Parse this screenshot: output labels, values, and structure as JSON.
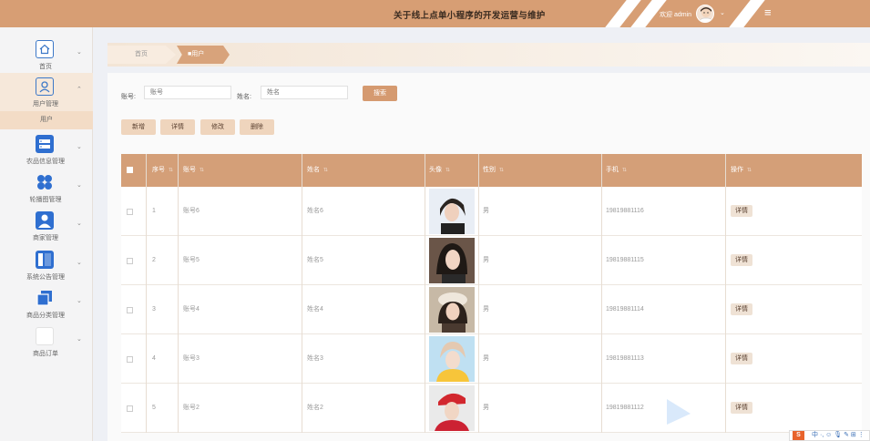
{
  "header": {
    "title": "关于线上点单小程序的开发运营与维护",
    "welcome": "欢迎 admin",
    "user_caret": "⌄",
    "menu_icon": "≡"
  },
  "sidebar": {
    "items": [
      {
        "label": "首页",
        "icon": "home-icon"
      },
      {
        "label": "用户管理",
        "icon": "user-icon"
      },
      {
        "label": "农品信息管理",
        "icon": "database-icon"
      },
      {
        "label": "轮播图管理",
        "icon": "grid-icon"
      },
      {
        "label": "商家管理",
        "icon": "person-icon"
      },
      {
        "label": "系统公告管理",
        "icon": "notice-icon"
      },
      {
        "label": "商品分类管理",
        "icon": "copy-icon"
      },
      {
        "label": "商品订单",
        "icon": "order-icon"
      }
    ],
    "submenu": {
      "label": "用户"
    },
    "chevron": "⌄",
    "chevron_open": "⌃"
  },
  "breadcrumb": {
    "home": "首页",
    "current": "■用户",
    "close": "×"
  },
  "search": {
    "account_label": "账号:",
    "account_placeholder": "账号",
    "name_label": "姓名:",
    "name_placeholder": "姓名",
    "button": "搜索"
  },
  "toolbar": {
    "add": "新增",
    "detail": "详情",
    "edit": "修改",
    "delete": "删除"
  },
  "table": {
    "columns": [
      "序号",
      "账号",
      "姓名",
      "头像",
      "性别",
      "手机",
      "操作"
    ],
    "sort_glyph": "⇅",
    "detail_label": "详情",
    "rows": [
      {
        "index": "1",
        "account": "账号6",
        "name": "姓名6",
        "gender": "男",
        "phone": "19819881116"
      },
      {
        "index": "2",
        "account": "账号5",
        "name": "姓名5",
        "gender": "男",
        "phone": "19819881115"
      },
      {
        "index": "3",
        "account": "账号4",
        "name": "姓名4",
        "gender": "男",
        "phone": "19819881114"
      },
      {
        "index": "4",
        "account": "账号3",
        "name": "姓名3",
        "gender": "男",
        "phone": "19819881113"
      },
      {
        "index": "5",
        "account": "账号2",
        "name": "姓名2",
        "gender": "男",
        "phone": "19819881112"
      }
    ]
  },
  "ime": {
    "logo": "S",
    "text": "中 ·, ☺ 🎙 ✎ ⊞ ⋮"
  },
  "colors": {
    "accent": "#d79e74",
    "table_header": "#d49f78",
    "button": "#efd5bd",
    "sidebar_icon": "#2f6fd0"
  }
}
